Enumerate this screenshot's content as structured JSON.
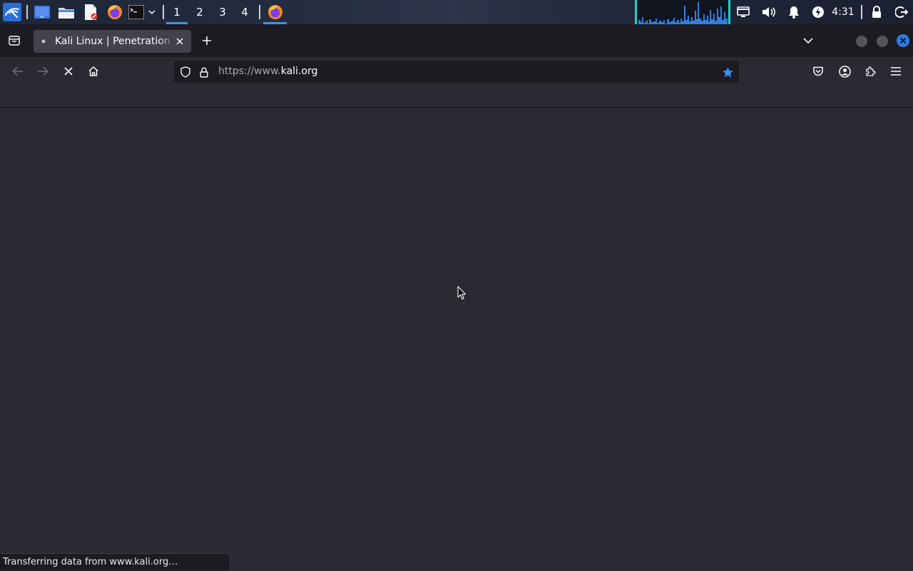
{
  "panel": {
    "workspaces": [
      "1",
      "2",
      "3",
      "4"
    ],
    "clock": "4:31"
  },
  "browser": {
    "tab_title": "Kali Linux | Penetration Testing and Ethical Hacking Linux Distribution",
    "url_prefix": "https://www.",
    "url_domain": "kali.org",
    "status_text": "Transferring data from www.kali.org…"
  },
  "colors": {
    "accent": "#4a90e2",
    "bookmark_star": "#3a8ee6",
    "close_button": "#2f7be6"
  }
}
